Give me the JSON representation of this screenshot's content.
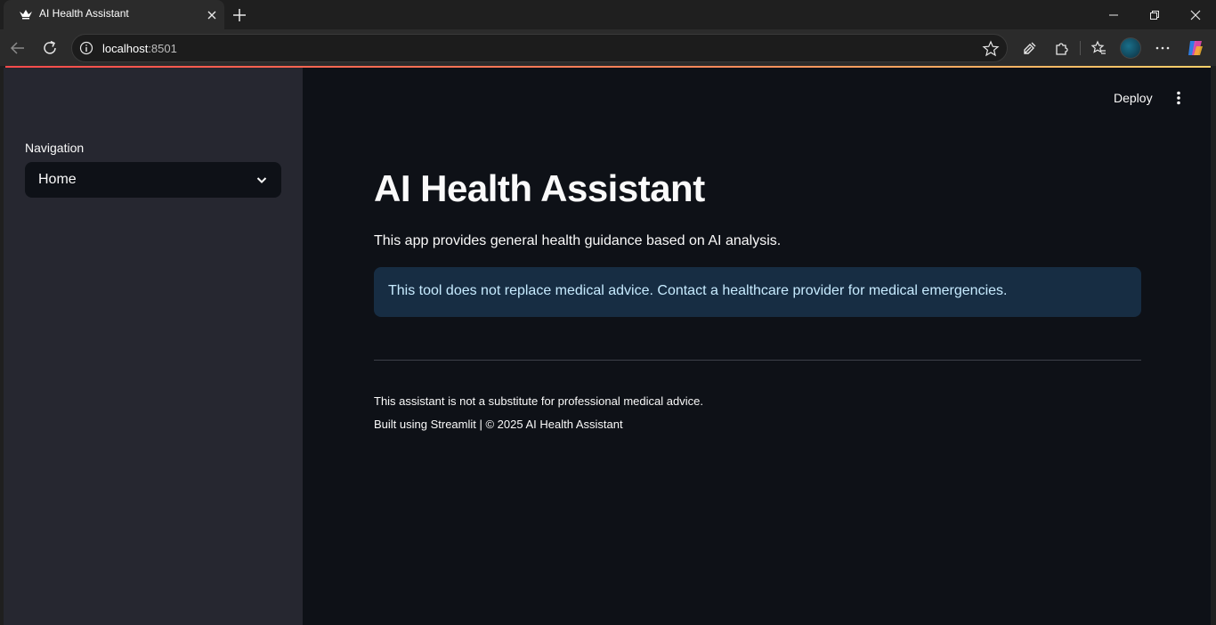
{
  "browser": {
    "tab": {
      "title": "AI Health Assistant",
      "favicon": "streamlit-crown-icon"
    },
    "address": {
      "host": "localhost",
      "port": ":8501"
    },
    "icons": [
      "back-arrow-icon",
      "reload-icon",
      "site-info-icon",
      "star-icon",
      "eyedropper-icon",
      "extensions-icon",
      "favorites-icon",
      "profile-avatar",
      "more-icon",
      "copilot-icon"
    ]
  },
  "app": {
    "header": {
      "deploy_label": "Deploy"
    },
    "sidebar": {
      "nav_label": "Navigation",
      "select_value": "Home"
    },
    "main": {
      "title": "AI Health Assistant",
      "intro": "This app provides general health guidance based on AI analysis.",
      "info": "This tool does not replace medical advice. Contact a healthcare provider for medical emergencies.",
      "footer_disclaimer": "This assistant is not a substitute for professional medical advice.",
      "footer_credits": "Built using Streamlit | © 2025 AI Health Assistant"
    }
  },
  "colors": {
    "app_bg": "#0e1117",
    "sidebar_bg": "#262730",
    "info_bg": "#172d43",
    "info_text": "#c7ebff",
    "accent": "#ff4b4b"
  }
}
